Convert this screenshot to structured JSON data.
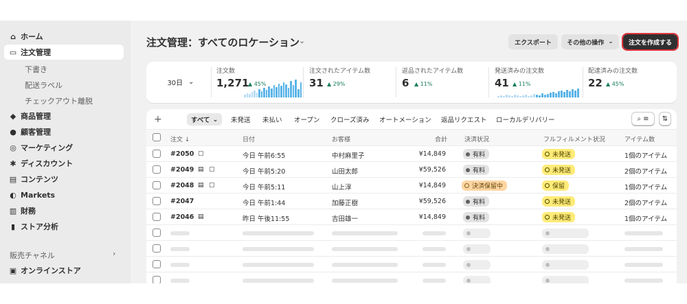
{
  "page": {
    "title": "注文管理：すべてのロケーション"
  },
  "header": {
    "export": "エクスポート",
    "more_actions": "その他の操作",
    "create_order": "注文を作成する"
  },
  "sidebar": {
    "items": [
      {
        "label": "ホーム",
        "icon": "home-icon"
      },
      {
        "label": "注文管理",
        "icon": "inbox-icon",
        "active": true
      },
      {
        "label": "商品管理",
        "icon": "tag-icon"
      },
      {
        "label": "顧客管理",
        "icon": "person-icon"
      },
      {
        "label": "マーケティング",
        "icon": "target-icon"
      },
      {
        "label": "ディスカウント",
        "icon": "discount-icon"
      },
      {
        "label": "コンテンツ",
        "icon": "content-icon"
      },
      {
        "label": "Markets",
        "icon": "globe-icon"
      },
      {
        "label": "財務",
        "icon": "bank-icon"
      },
      {
        "label": "ストア分析",
        "icon": "bar-chart-icon"
      }
    ],
    "sub_items": [
      "下書き",
      "配送ラベル",
      "チェックアウト離脱"
    ],
    "channels_label": "販売チャネル",
    "online_store": "オンラインストア"
  },
  "stats": {
    "period": "30日",
    "cards": [
      {
        "label": "注文数",
        "value": "1,271",
        "delta": "45%"
      },
      {
        "label": "注文されたアイテム数",
        "value": "31",
        "delta": "29%"
      },
      {
        "label": "返品されたアイテム数",
        "value": "6",
        "delta": "11%"
      },
      {
        "label": "発送済みの注文数",
        "value": "41",
        "delta": "11%"
      },
      {
        "label": "配達済みの注文数",
        "value": "22",
        "delta": "45%"
      }
    ]
  },
  "tabs": [
    "すべて",
    "未発送",
    "未払い",
    "オープン",
    "クローズ済み",
    "オートメーション",
    "返品リクエスト",
    "ローカルデリバリー"
  ],
  "table": {
    "columns": [
      "注文",
      "日付",
      "お客様",
      "合計",
      "決済状況",
      "フルフィルメント状況",
      "アイテム数"
    ],
    "rows": [
      {
        "order": "#2050",
        "date": "今日 午前6:55",
        "customer": "中村麻里子",
        "total": "¥14,849",
        "payment": "有料",
        "fulfillment": "未発送",
        "items": "1個のアイテム"
      },
      {
        "order": "#2049",
        "date": "今日 午前5:20",
        "customer": "山田太郎",
        "total": "¥59,526",
        "payment": "有料",
        "fulfillment": "未発送",
        "items": "2個のアイテム"
      },
      {
        "order": "#2048",
        "date": "今日 午前5:11",
        "customer": "山上淳",
        "total": "¥14,849",
        "payment": "決済保留中",
        "fulfillment": "保留",
        "items": "1個のアイテム"
      },
      {
        "order": "#2047",
        "date": "今日 午前1:44",
        "customer": "加藤正樹",
        "total": "¥59,526",
        "payment": "有料",
        "fulfillment": "未発送",
        "items": "2個のアイテム"
      },
      {
        "order": "#2046",
        "date": "昨日 午後11:55",
        "customer": "吉田雄一",
        "total": "¥14,849",
        "payment": "有料",
        "fulfillment": "未発送",
        "items": "1個のアイテム"
      }
    ]
  }
}
